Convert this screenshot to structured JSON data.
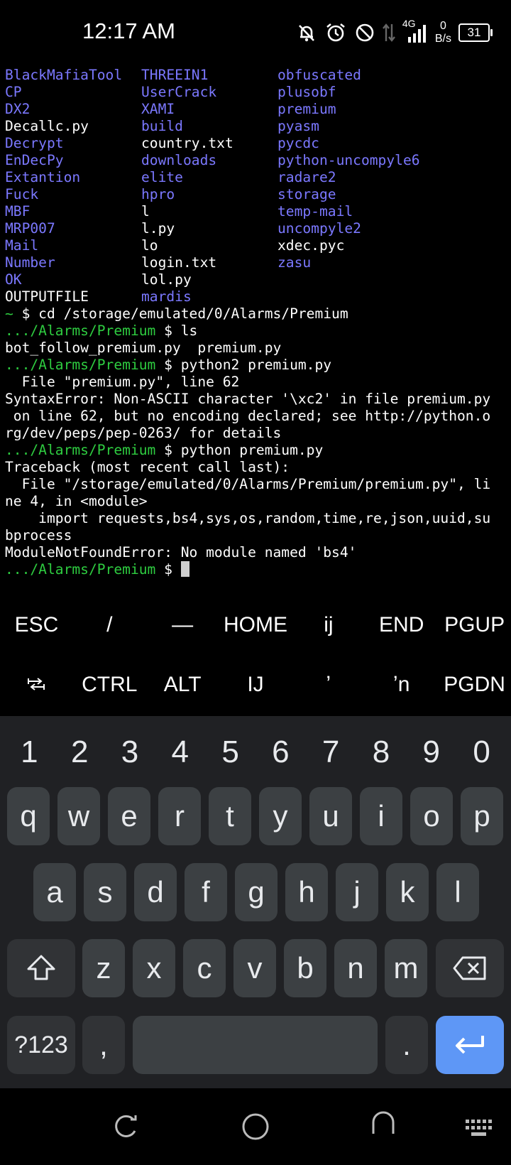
{
  "status_bar": {
    "time": "12:17 AM",
    "net_type": "4G",
    "speed_value": "0",
    "speed_unit": "B/s",
    "battery": "31",
    "icons": [
      "mute-bell-icon",
      "alarm-icon",
      "do-not-disturb-icon",
      "data-arrows-icon",
      "signal-icon",
      "battery-icon"
    ]
  },
  "terminal": {
    "ls_rows": [
      [
        {
          "t": "BlackMafiaTool",
          "k": "dir"
        },
        {
          "t": "THREEIN1",
          "k": "dir"
        },
        {
          "t": "obfuscated",
          "k": "dir"
        }
      ],
      [
        {
          "t": "CP",
          "k": "dir"
        },
        {
          "t": "UserCrack",
          "k": "dir"
        },
        {
          "t": "plusobf",
          "k": "dir"
        }
      ],
      [
        {
          "t": "DX2",
          "k": "dir"
        },
        {
          "t": "XAMI",
          "k": "dir"
        },
        {
          "t": "premium",
          "k": "dir"
        }
      ],
      [
        {
          "t": "Decallc.py",
          "k": "file"
        },
        {
          "t": "build",
          "k": "dir"
        },
        {
          "t": "pyasm",
          "k": "dir"
        }
      ],
      [
        {
          "t": "Decrypt",
          "k": "dir"
        },
        {
          "t": "country.txt",
          "k": "file"
        },
        {
          "t": "pycdc",
          "k": "dir"
        }
      ],
      [
        {
          "t": "EnDecPy",
          "k": "dir"
        },
        {
          "t": "downloads",
          "k": "dir"
        },
        {
          "t": "python-uncompyle6",
          "k": "dir"
        }
      ],
      [
        {
          "t": "Extantion",
          "k": "dir"
        },
        {
          "t": "elite",
          "k": "dir"
        },
        {
          "t": "radare2",
          "k": "dir"
        }
      ],
      [
        {
          "t": "Fuck",
          "k": "dir"
        },
        {
          "t": "hpro",
          "k": "dir"
        },
        {
          "t": "storage",
          "k": "dir"
        }
      ],
      [
        {
          "t": "MBF",
          "k": "dir"
        },
        {
          "t": "l",
          "k": "file"
        },
        {
          "t": "temp-mail",
          "k": "dir"
        }
      ],
      [
        {
          "t": "MRP007",
          "k": "dir"
        },
        {
          "t": "l.py",
          "k": "file"
        },
        {
          "t": "uncompyle2",
          "k": "dir"
        }
      ],
      [
        {
          "t": "Mail",
          "k": "dir"
        },
        {
          "t": "lo",
          "k": "file"
        },
        {
          "t": "xdec.pyc",
          "k": "file"
        }
      ],
      [
        {
          "t": "Number",
          "k": "dir"
        },
        {
          "t": "login.txt",
          "k": "file"
        },
        {
          "t": "zasu",
          "k": "dir"
        }
      ],
      [
        {
          "t": "OK",
          "k": "dir"
        },
        {
          "t": "lol.py",
          "k": "file"
        },
        {
          "t": "",
          "k": "file"
        }
      ],
      [
        {
          "t": "OUTPUTFILE",
          "k": "file"
        },
        {
          "t": "mardis",
          "k": "dir"
        },
        {
          "t": "",
          "k": "file"
        }
      ]
    ],
    "lines": [
      {
        "prompt": "~",
        "cmd": " $ cd /storage/emulated/0/Alarms/Premium"
      },
      {
        "prompt": ".../Alarms/Premium",
        "cmd": " $ ls"
      },
      {
        "prompt": "",
        "cmd": "bot_follow_premium.py  premium.py"
      },
      {
        "prompt": ".../Alarms/Premium",
        "cmd": " $ python2 premium.py"
      },
      {
        "prompt": "",
        "cmd": "  File \"premium.py\", line 62"
      },
      {
        "prompt": "",
        "cmd": "SyntaxError: Non-ASCII character '\\xc2' in file premium.py"
      },
      {
        "prompt": "",
        "cmd": " on line 62, but no encoding declared; see http://python.o"
      },
      {
        "prompt": "",
        "cmd": "rg/dev/peps/pep-0263/ for details"
      },
      {
        "prompt": ".../Alarms/Premium",
        "cmd": " $ python premium.py"
      },
      {
        "prompt": "",
        "cmd": "Traceback (most recent call last):"
      },
      {
        "prompt": "",
        "cmd": "  File \"/storage/emulated/0/Alarms/Premium/premium.py\", li"
      },
      {
        "prompt": "",
        "cmd": "ne 4, in <module>"
      },
      {
        "prompt": "",
        "cmd": "    import requests,bs4,sys,os,random,time,re,json,uuid,su"
      },
      {
        "prompt": "",
        "cmd": "bprocess"
      },
      {
        "prompt": "",
        "cmd": "ModuleNotFoundError: No module named 'bs4'"
      }
    ],
    "current_prompt": ".../Alarms/Premium",
    "current_suffix": " $ "
  },
  "extra_keys": {
    "row1": [
      "ESC",
      "/",
      "—",
      "HOME",
      "ij",
      "END",
      "PGUP"
    ],
    "row2": [
      "⭾",
      "CTRL",
      "ALT",
      "IJ",
      "ʼ",
      "ʼn",
      "PGDN"
    ]
  },
  "keyboard": {
    "numbers": [
      "1",
      "2",
      "3",
      "4",
      "5",
      "6",
      "7",
      "8",
      "9",
      "0"
    ],
    "row1": [
      "q",
      "w",
      "e",
      "r",
      "t",
      "y",
      "u",
      "i",
      "o",
      "p"
    ],
    "row2": [
      "a",
      "s",
      "d",
      "f",
      "g",
      "h",
      "j",
      "k",
      "l"
    ],
    "row3": [
      "z",
      "x",
      "c",
      "v",
      "b",
      "n",
      "m"
    ],
    "symbols_label": "?123",
    "comma": ",",
    "period": "."
  },
  "nav_bar": {
    "icons": [
      "recents-icon",
      "home-icon",
      "back-icon",
      "keyboard-switch-icon"
    ]
  }
}
